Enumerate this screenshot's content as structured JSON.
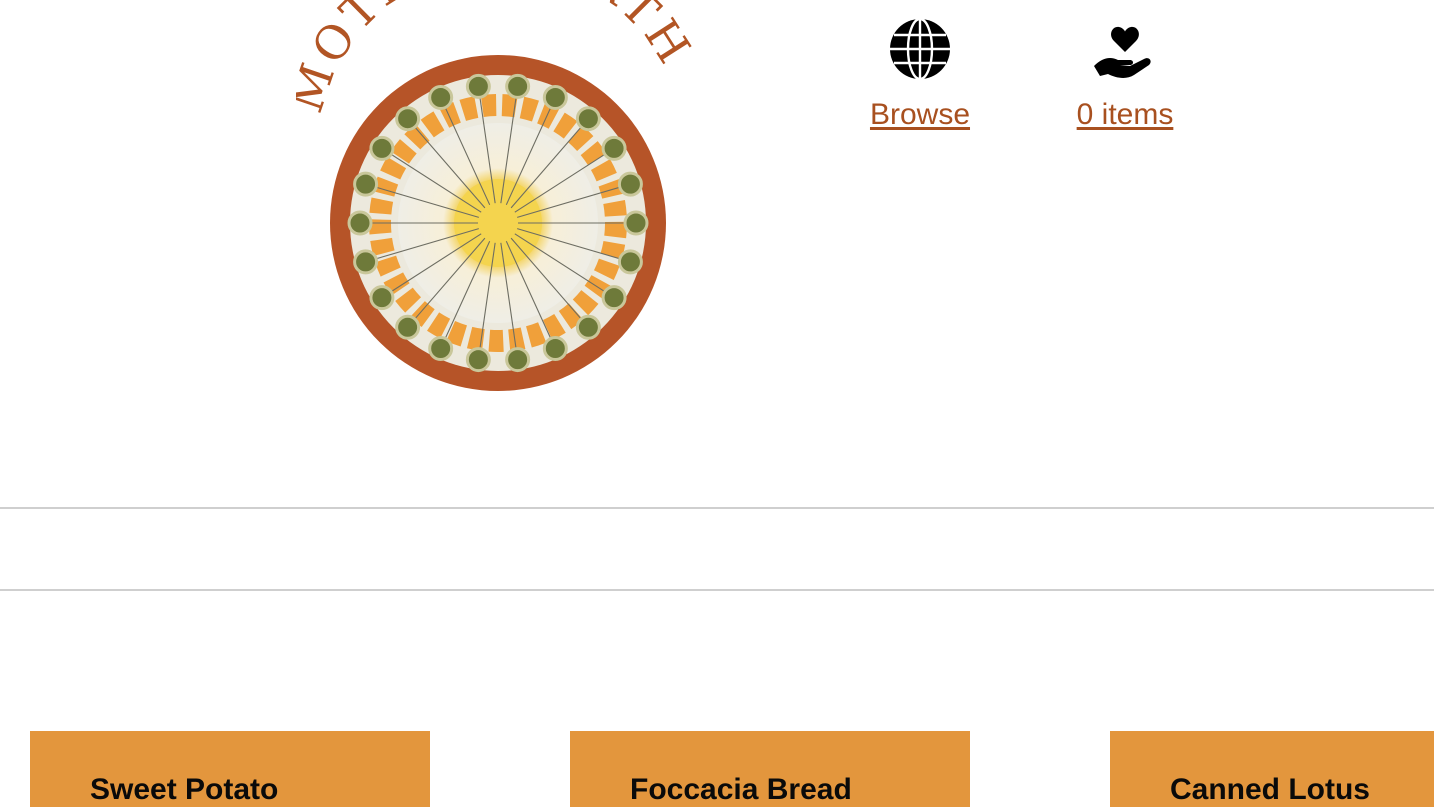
{
  "brand": {
    "logo_text": "MOTHER EARTH"
  },
  "nav": {
    "browse": {
      "label": "Browse",
      "icon": "globe-icon"
    },
    "cart": {
      "label": "0 items",
      "icon": "heart-in-hand-icon"
    }
  },
  "products": [
    {
      "name": "Sweet Potato"
    },
    {
      "name": "Foccacia Bread"
    },
    {
      "name": "Canned Lotus"
    }
  ],
  "colors": {
    "accent": "#b25524",
    "link": "#a8501f",
    "card": "#e3963d",
    "logo_ring": "#b65428",
    "logo_orange": "#f0a03a",
    "logo_yellow": "#f4d44e",
    "divider": "#cfcfcf"
  }
}
